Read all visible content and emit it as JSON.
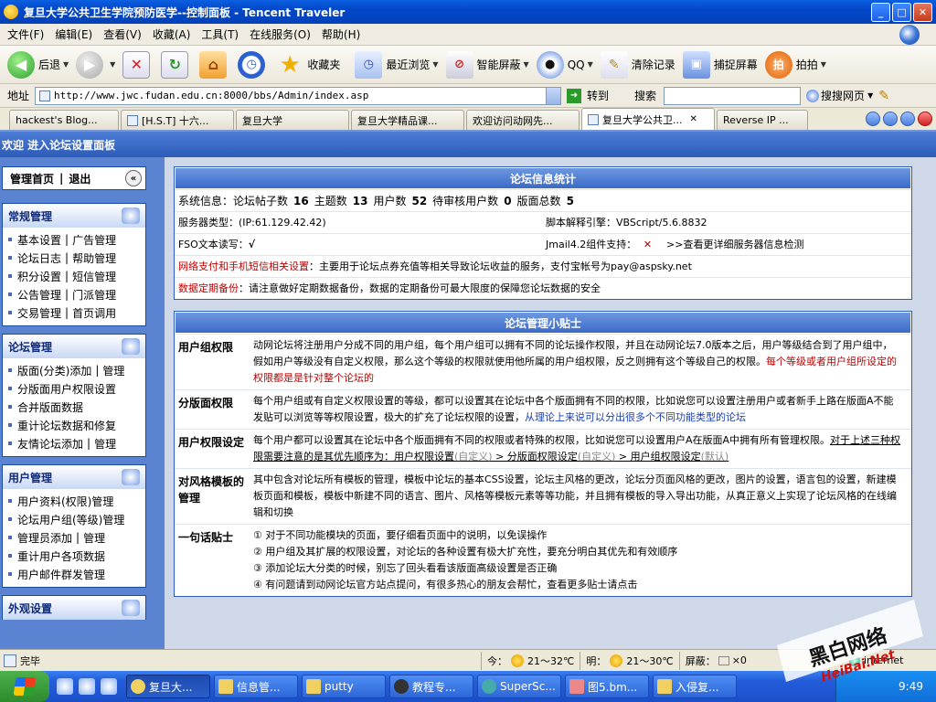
{
  "window": {
    "title": "复旦大学公共卫生学院预防医学--控制面板 - Tencent Traveler",
    "min": "_",
    "max": "□",
    "close": "✕"
  },
  "menu": [
    "文件(F)",
    "编辑(E)",
    "查看(V)",
    "收藏(A)",
    "工具(T)",
    "在线服务(O)",
    "帮助(H)"
  ],
  "toolbar": {
    "back": "后退",
    "favorites": "收藏夹",
    "recent": "最近浏览",
    "smart_block": "智能屏蔽",
    "qq": "QQ",
    "clear": "清除记录",
    "capture": "捕捉屏幕",
    "paipai": "拍拍"
  },
  "address": {
    "label": "地址",
    "url": "http://www.jwc.fudan.edu.cn:8000/bbs/Admin/index.asp",
    "go": "转到",
    "search_label": "搜索",
    "search_web": "搜搜网页"
  },
  "tabs": [
    "hackest's Blog...",
    "[H.S.T] 十六...",
    "复旦大学",
    "复旦大学精品课...",
    "欢迎访问动网先...",
    "复旦大学公共卫...",
    "Reverse IP ..."
  ],
  "page": {
    "header": "欢迎 进入论坛设置面板"
  },
  "sidebar": {
    "home": "管理首页",
    "logout": "退出",
    "sections": [
      {
        "title": "常规管理",
        "rows": [
          [
            "基本设置",
            "广告管理"
          ],
          [
            "论坛日志",
            "帮助管理"
          ],
          [
            "积分设置",
            "短信管理"
          ],
          [
            "公告管理",
            "门派管理"
          ],
          [
            "交易管理",
            "首页调用"
          ]
        ]
      },
      {
        "title": "论坛管理",
        "rows": [
          [
            "版面(分类)添加",
            "管理"
          ],
          [
            "分版面用户权限设置"
          ],
          [
            "合并版面数据"
          ],
          [
            "重计论坛数据和修复"
          ],
          [
            "友情论坛添加",
            "管理"
          ]
        ]
      },
      {
        "title": "用户管理",
        "rows": [
          [
            "用户资料(权限)管理"
          ],
          [
            "论坛用户组(等级)管理"
          ],
          [
            "管理员添加",
            "管理"
          ],
          [
            "重计用户各项数据"
          ],
          [
            "用户邮件群发管理"
          ]
        ]
      },
      {
        "title": "外观设置",
        "rows": []
      }
    ]
  },
  "stats": {
    "title": "论坛信息统计",
    "sysinfo_label": "系统信息：",
    "sysinfo": [
      {
        "label": "论坛帖子数",
        "value": "16"
      },
      {
        "label": "主题数",
        "value": "13"
      },
      {
        "label": "用户数",
        "value": "52"
      },
      {
        "label": "待审核用户数",
        "value": "0"
      },
      {
        "label": "版面总数",
        "value": "5"
      }
    ],
    "server_type": "服务器类型：(IP:61.129.42.42)",
    "script_engine": "脚本解释引擎：VBScript/5.6.8832",
    "fso": "FSO文本读写：",
    "fso_value": "√",
    "jmail": "Jmail4.2组件支持：",
    "jmail_value": "✕",
    "detail_link": ">>查看更详细服务器信息检测",
    "payment_label": "网络支付和手机短信相关设置",
    "payment_text": "：主要用于论坛点券充值等相关导致论坛收益的服务，支付宝帐号为pay@aspsky.net",
    "backup_label": "数据定期备份",
    "backup_text": "：请注意做好定期数据备份，数据的定期备份可最大限度的保障您论坛数据的安全"
  },
  "tips": {
    "title": "论坛管理小贴士",
    "group_label": "用户组权限",
    "group_text": "动网论坛将注册用户分成不同的用户组，每个用户组可以拥有不同的论坛操作权限，并且在动网论坛7.0版本之后，用户等级结合到了用户组中，假如用户等级没有自定义权限，那么这个等级的权限就使用他所属的用户组权限，反之则拥有这个等级自己的权限。",
    "group_red": "每个等级或者用户组所设定的权限都是是针对整个论坛的",
    "board_label": "分版面权限",
    "board_text": "每个用户组或有自定义权限设置的等级，都可以设置其在论坛中各个版面拥有不同的权限，比如说您可以设置注册用户或者新手上路在版面A不能发贴可以浏览等等权限设置，极大的扩充了论坛权限的设置，",
    "board_blue": "从理论上来说可以分出很多个不同功能类型的论坛",
    "user_label": "用户权限设定",
    "user_text": "每个用户都可以设置其在论坛中各个版面拥有不同的权限或者特殊的权限，比如说您可以设置用户A在版面A中拥有所有管理权限。",
    "user_ul1": "对于上述三种权限需要注意的是其优先顺序为：用户权限设置",
    "user_c1": "(自定义)",
    "user_ul2": " > 分版面权限设定",
    "user_c2": "(自定义)",
    "user_ul3": " > 用户组权限设定",
    "user_c3": "(默认)",
    "style_label": "对风格模板的管理",
    "style_text": "其中包含对论坛所有模板的管理，模板中论坛的基本CSS设置，论坛主风格的更改，论坛分页面风格的更改，图片的设置，语言包的设置，新建模板页面和模板，模板中新建不同的语言、图片、风格等模板元素等等功能，并且拥有模板的导入导出功能，从真正意义上实现了论坛风格的在线编辑和切换",
    "oneline_label": "一句话贴士",
    "oneline": [
      "① 对于不同功能模块的页面，要仔细看页面中的说明，以免误操作",
      "② 用户组及其扩展的权限设置，对论坛的各种设置有极大扩充性，要充分明白其优先和有效顺序",
      "③ 添加论坛大分类的时候，别忘了回头看看该版面高级设置是否正确",
      "④ 有问题请到动网论坛官方站点提问，有很多热心的朋友会帮忙，查看更多贴士请点击"
    ]
  },
  "status": {
    "text": "完毕",
    "today": "今：",
    "today_temp": "21～32℃",
    "tomorrow": "明：",
    "tomorrow_temp": "21～30℃",
    "block": "屏蔽：",
    "block_count": "×0",
    "zone": "internet"
  },
  "taskbar": {
    "tasks": [
      "复旦大...",
      "信息管...",
      "putty",
      "教程专...",
      "SuperSc...",
      "图5.bm...",
      "入侵复..."
    ],
    "clock": "9:49"
  },
  "watermark": {
    "line1": "黑白网络",
    "line2": "HeiBai.Net"
  },
  "colors": {
    "accent": "#2d5cb8",
    "red": "#c00000",
    "blue": "#1a3fb0"
  }
}
